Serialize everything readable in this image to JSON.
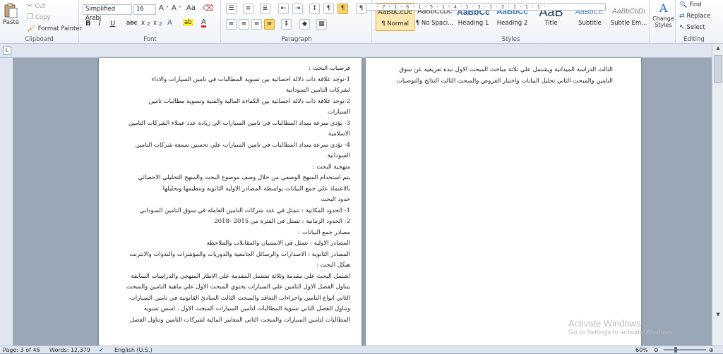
{
  "clipboard": {
    "paste_label": "Paste",
    "cut_label": "Cut",
    "copy_label": "Copy",
    "format_painter_label": "Format Painter",
    "group_label": "Clipboard"
  },
  "font": {
    "font_name": "Simplified Arabi",
    "font_size": "16",
    "group_label": "Font"
  },
  "paragraph": {
    "group_label": "Paragraph"
  },
  "styles": {
    "group_label": "Styles",
    "items": [
      {
        "sample": "AaBbCcDc",
        "name": "¶ Normal"
      },
      {
        "sample": "AaBbCcDc",
        "name": "¶ No Spaci..."
      },
      {
        "sample": "AaBbCc",
        "name": "Heading 1"
      },
      {
        "sample": "AaBbCc",
        "name": "Heading 2"
      },
      {
        "sample": "AaB",
        "name": "Title"
      },
      {
        "sample": "AaBbCc.",
        "name": "Subtitle"
      },
      {
        "sample": "AaBbCcDı",
        "name": "Subtle Em..."
      }
    ],
    "change_styles_label": "Change Styles"
  },
  "editing": {
    "find_label": "Find",
    "replace_label": "Replace",
    "select_label": "Select",
    "group_label": "Editing"
  },
  "ruler": {
    "numbers": "· 7 · 1 · 6 · 1 · 5 · 1 · 4 · 1 · 3 · 1 · 2 · 1 · 1 · 1 ·",
    "corner": "L"
  },
  "page_left": {
    "lines": [
      "فرضيات البحث :",
      "1-توجد علاقة ذات دلالة احصائية بين تسوية المطالبات في تامين السيارات والاداء",
      "لشركات التامين السودانية",
      "2-توجد علاقة ذات دلالة احصائية بين الكفاءة المالية والفنية وتسوية مطالبات تامين",
      "السيارات",
      "3- يؤدي سرعة سداد المطالبات في تامين السيارات الي زيادة عدد عملاء الشركات التامين",
      "الاسلامية",
      "4- تؤدي سرعة سداد المطالبات في تامين السيارات علي تحسين سمعة شركات التامين",
      "السودانية",
      "منهجية البحث :",
      "يتم استخدام المنهج الوصفي من خلال وصف موضوع البحث والمنهج التحليلي الاحصائي",
      "بالاعتماد علي جمع البيانات بواسطة المصادر الاولية الثانوية وتنظيمها وتحليلها",
      "حدود البحث",
      "1- الحدود المكانية : تتمثل في عدد شركات التامين العاملة في سوق التامين السوداني",
      "2- الحدود الزمانية : تتمثل في الفترة من 2015 -2018",
      "مصادر جمع البيانات :",
      "المصادر الاولية : تتمثل في الاستبيان والمقابلات والملاحظة",
      "المصادر الثانوية : الاصدارات والرسائل الجامعية والدوريات والمؤشرات والندوات والانترنت",
      "هيكل البحث :",
      "اشتمل البحث علي مقدمة وثلاثة تشتمل المقدمة علي الاطار المنهجي والدراسات السابقة",
      "يتناول الفصل الاول التامين علي السيارات يحتوي المبحث الاول علي ماهية التامين والمبحث",
      "الثاني انواع التامين واجراءات التعاقد والمبحث الثالث المبادئ القانونية في تأمين السيارات",
      "وتناول الفصل الثاني تسوية المطالبات لتامين السيارات المبحث الاول ، اسس تسوية",
      "المطالبات لتامين السيارات والمبحث الثاني المعايير المالية لشركات التامين وتناول الفصل"
    ]
  },
  "page_right": {
    "lines": [
      "الثالث الدراسة الميدانية ويشتمل علي ثلاثة مباحث المبحث الاول نبذة تعريفية عن سوق",
      "التامين والمبحث الثاني تحليل البيانات واختبار الفروض والمبحث الثالث النتائج والتوصيات"
    ]
  },
  "status": {
    "page": "Page: 3 of 46",
    "words": "Words: 12,379",
    "language": "English (U.S.)",
    "zoom": "60%"
  },
  "watermark": {
    "title": "Activate Windows",
    "subtitle": "Go to Settings to activate Windows."
  }
}
